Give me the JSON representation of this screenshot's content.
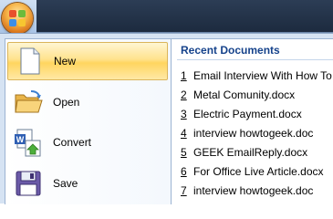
{
  "office_menu": {
    "commands": [
      {
        "label": "New",
        "icon": "new-document-icon",
        "active": true
      },
      {
        "label": "Open",
        "icon": "open-folder-icon",
        "active": false
      },
      {
        "label": "Convert",
        "icon": "convert-icon",
        "active": false
      },
      {
        "label": "Save",
        "icon": "save-icon",
        "active": false
      }
    ]
  },
  "recent": {
    "title": "Recent Documents",
    "items": [
      {
        "num": "1",
        "name": "Email Interview With How To"
      },
      {
        "num": "2",
        "name": "Metal Comunity.docx"
      },
      {
        "num": "3",
        "name": "Electric Payment.docx"
      },
      {
        "num": "4",
        "name": "interview howtogeek.doc"
      },
      {
        "num": "5",
        "name": "GEEK EmailReply.docx"
      },
      {
        "num": "6",
        "name": "For Office Live Article.docx"
      },
      {
        "num": "7",
        "name": "interview howtogeek.doc"
      }
    ]
  },
  "colors": {
    "highlight": "#ffd55f",
    "heading": "#15428b"
  }
}
